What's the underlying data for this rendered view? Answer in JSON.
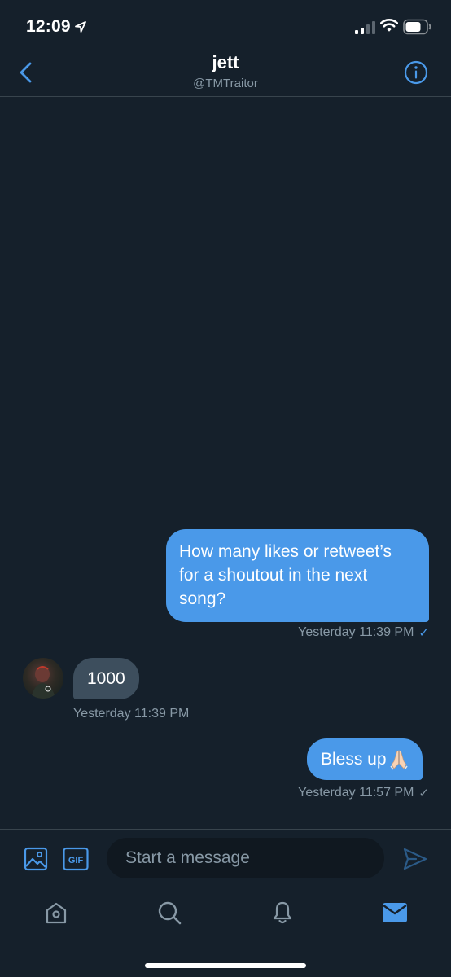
{
  "status_bar": {
    "time": "12:09"
  },
  "header": {
    "name": "jett",
    "handle": "@TMTraitor"
  },
  "messages": [
    {
      "direction": "sent",
      "text": "How many likes or retweet’s for a shoutout in the next song?",
      "timestamp": "Yesterday 11:39 PM",
      "read": true
    },
    {
      "direction": "received",
      "text": "1000",
      "timestamp": "Yesterday 11:39 PM"
    },
    {
      "direction": "sent",
      "text": "Bless up",
      "emoji": "folded-hands",
      "timestamp": "Yesterday 11:57 PM",
      "read": false
    }
  ],
  "composer": {
    "placeholder": "Start a message",
    "gif_label": "GIF"
  },
  "tabs": [
    {
      "name": "home",
      "active": false
    },
    {
      "name": "search",
      "active": false
    },
    {
      "name": "notifications",
      "active": false
    },
    {
      "name": "messages",
      "active": true
    }
  ],
  "colors": {
    "background": "#15202b",
    "accent": "#4a99e9",
    "received_bubble": "#3d4e5d",
    "muted_text": "#8899a6",
    "divider": "#38444d"
  }
}
